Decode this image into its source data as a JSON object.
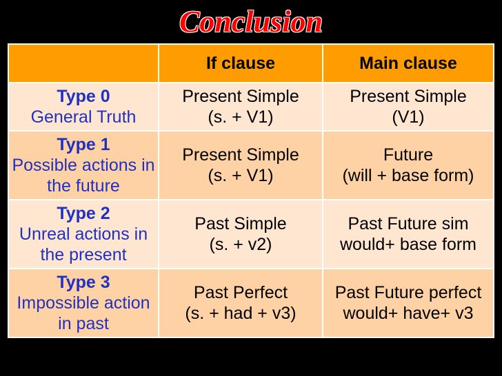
{
  "title": "Conclusion",
  "header": {
    "col0": "",
    "col1": "If    clause",
    "col2": "Main clause"
  },
  "rows": [
    {
      "type": "Type 0",
      "desc": "General Truth",
      "if": "Present Simple\n(s. + V1)",
      "main": "Present Simple\n(V1)"
    },
    {
      "type": "Type 1",
      "desc": "Possible actions in the future",
      "if": "Present Simple\n(s. + V1)",
      "main": "Future\n(will + base form)"
    },
    {
      "type": "Type 2",
      "desc": "Unreal actions in the present",
      "if": "Past Simple\n(s. + v2)",
      "main": "Past Future sim\nwould+ base form"
    },
    {
      "type": "Type 3",
      "desc": "Impossible action in past",
      "if": "Past Perfect\n(s. + had + v3)",
      "main": "Past Future perfect\nwould+ have+ v3"
    }
  ]
}
